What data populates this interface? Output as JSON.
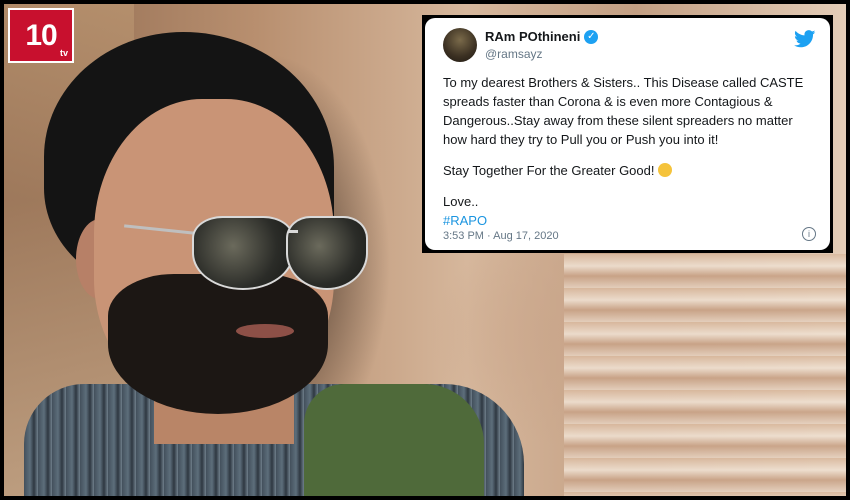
{
  "logo": {
    "text": "10",
    "sub": "tv"
  },
  "tweet": {
    "name": "RAm POthineni",
    "handle": "@ramsayz",
    "verified": "✓",
    "paragraph1": "To my dearest Brothers & Sisters.. This Disease called CASTE spreads faster than Corona & is even more Contagious & Dangerous..Stay away from these silent spreaders no matter how hard they try to Pull you or Push you into it!",
    "paragraph2": "Stay Together For the Greater Good!",
    "signoff": "Love..",
    "hashtag": "#RAPO",
    "timestamp": "3:53 PM · Aug 17, 2020",
    "info_glyph": "i",
    "colors": {
      "brand_blue": "#1da1f2",
      "link": "#1b95e0",
      "muted": "#657786"
    },
    "icons": [
      "twitter-bird-icon",
      "verified-badge-icon",
      "clapping-hands-emoji-icon",
      "info-icon"
    ]
  },
  "colors": {
    "logo_red": "#c8102e",
    "frame_border": "#000000"
  }
}
